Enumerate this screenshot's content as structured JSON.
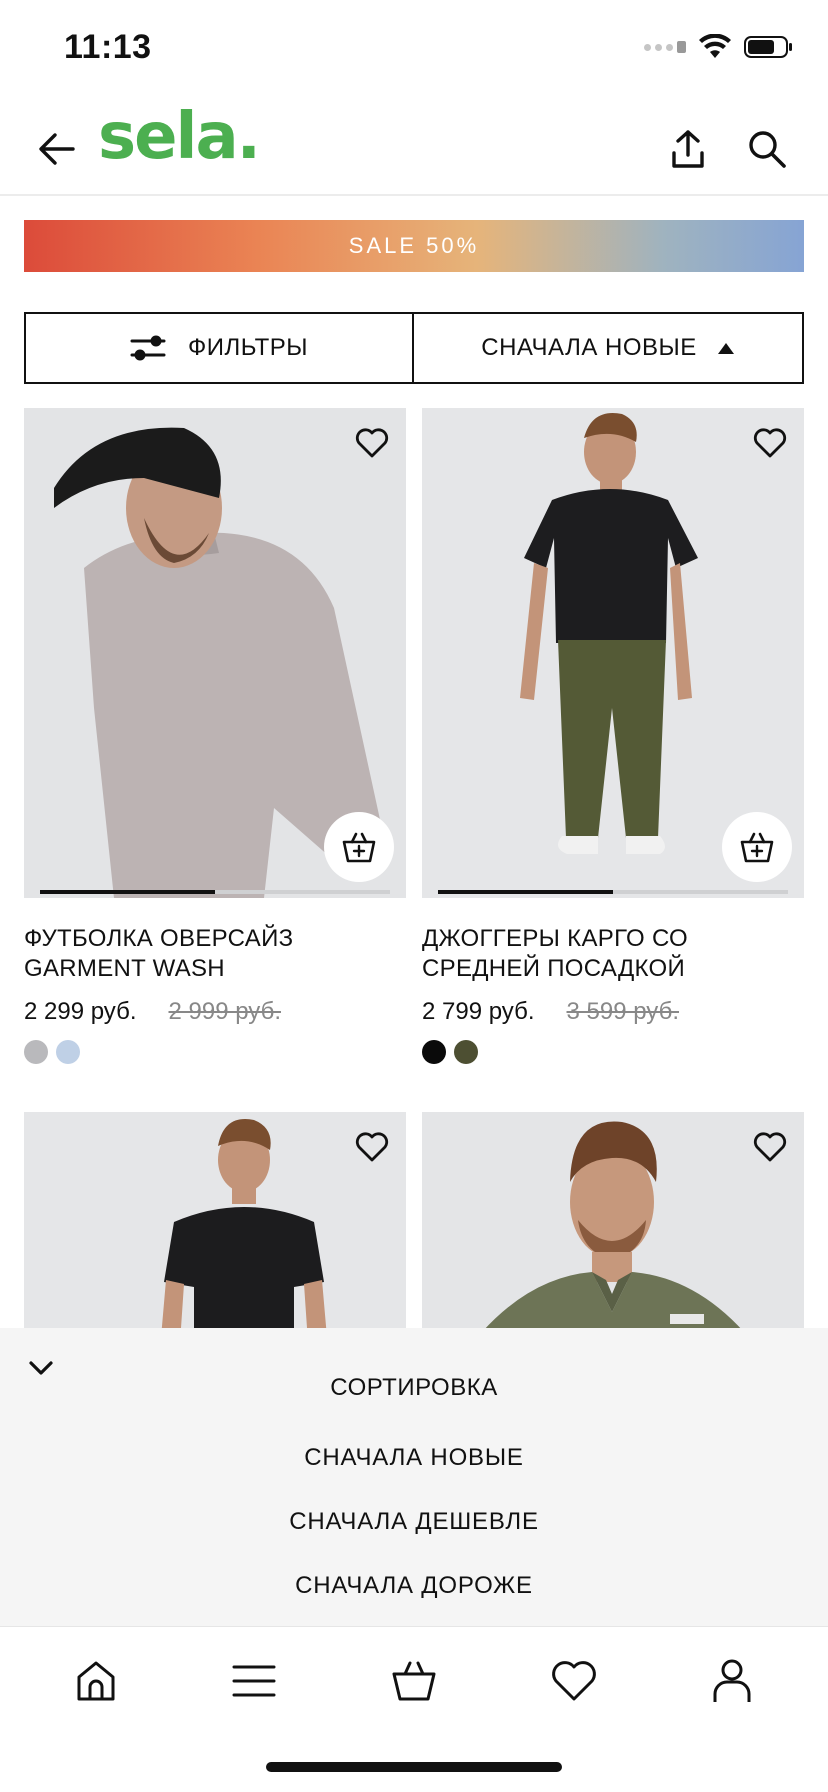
{
  "status": {
    "time": "11:13"
  },
  "header": {
    "logo": "sela."
  },
  "banner": {
    "text": "SALE 50%"
  },
  "toolbar": {
    "filters_label": "ФИЛЬТРЫ",
    "sort_label": "СНАЧАЛА НОВЫЕ"
  },
  "products": [
    {
      "name": "ФУТБОЛКА ОВЕРСАЙЗ GARMENT WASH",
      "price": "2 299 руб.",
      "old_price": "2 999 руб.",
      "colors": [
        "#b9b9bc",
        "#bfd0e6"
      ],
      "gallery_progress": 0.5
    },
    {
      "name": "ДЖОГГЕРЫ КАРГО СО СРЕДНЕЙ ПОСАДКОЙ",
      "price": "2 799 руб.",
      "old_price": "3 599 руб.",
      "colors": [
        "#0a0a0a",
        "#4d4f32"
      ],
      "gallery_progress": 0.5
    },
    {
      "name": "",
      "price": "",
      "old_price": "",
      "colors": []
    },
    {
      "name": "",
      "price": "",
      "old_price": "",
      "colors": []
    }
  ],
  "sort_sheet": {
    "title": "СОРТИРОВКА",
    "options": [
      "СНАЧАЛА НОВЫЕ",
      "СНАЧАЛА ДЕШЕВЛЕ",
      "СНАЧАЛА ДОРОЖЕ"
    ]
  },
  "tabs": [
    "home-icon",
    "menu-icon",
    "basket-icon",
    "heart-icon",
    "profile-icon"
  ]
}
